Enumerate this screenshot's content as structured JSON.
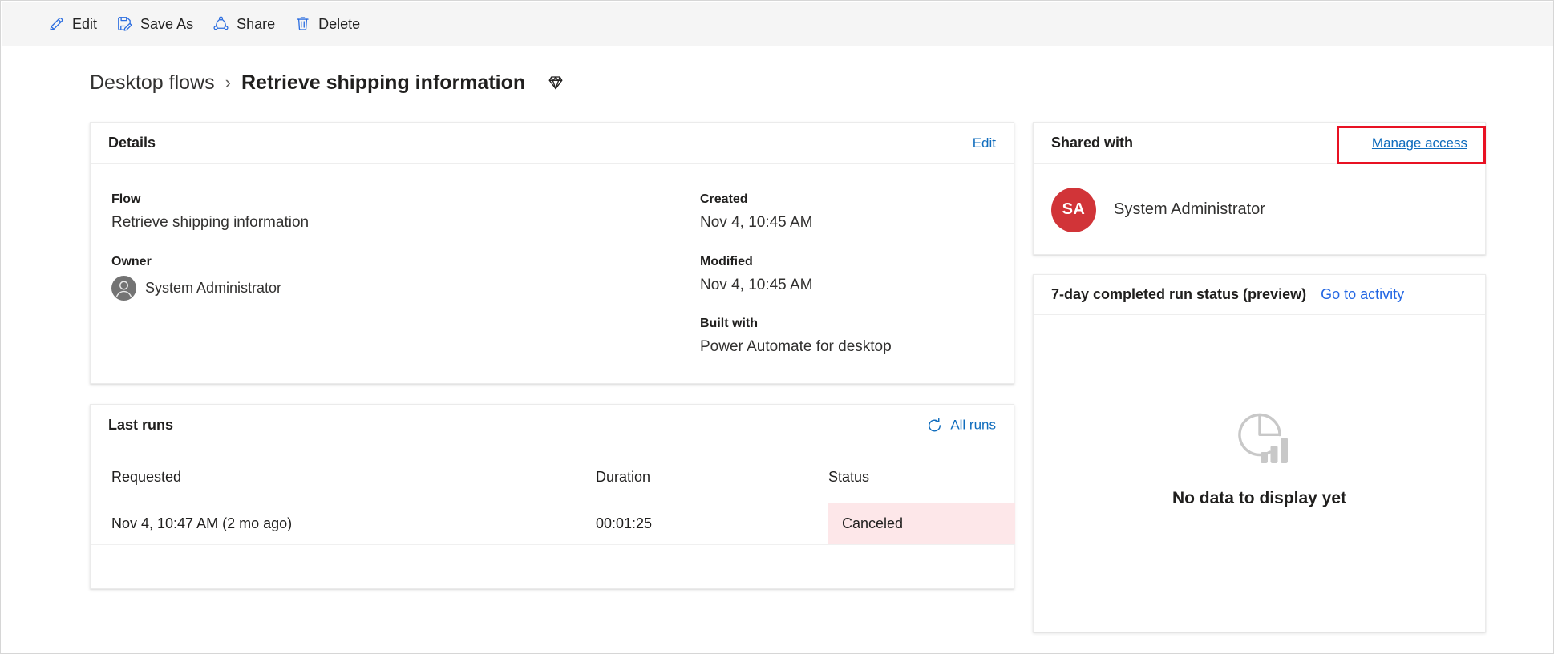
{
  "commandbar": {
    "items": [
      {
        "id": "edit",
        "label": "Edit",
        "icon": "pencil-icon"
      },
      {
        "id": "saveas",
        "label": "Save As",
        "icon": "save-as-icon"
      },
      {
        "id": "share",
        "label": "Share",
        "icon": "share-icon"
      },
      {
        "id": "delete",
        "label": "Delete",
        "icon": "trash-icon"
      }
    ]
  },
  "breadcrumb": {
    "parent": "Desktop flows",
    "separator": "›",
    "current": "Retrieve shipping information",
    "badge_icon": "gem-icon"
  },
  "details": {
    "title": "Details",
    "edit_label": "Edit",
    "fields": {
      "flow_label": "Flow",
      "flow_value": "Retrieve shipping information",
      "owner_label": "Owner",
      "owner_value": "System Administrator",
      "created_label": "Created",
      "created_value": "Nov 4, 10:45 AM",
      "modified_label": "Modified",
      "modified_value": "Nov 4, 10:45 AM",
      "built_with_label": "Built with",
      "built_with_value": "Power Automate for desktop"
    }
  },
  "last_runs": {
    "title": "Last runs",
    "all_runs_label": "All runs",
    "refresh_icon": "refresh-icon",
    "columns": [
      "Requested",
      "Duration",
      "Status"
    ],
    "rows": [
      {
        "requested": "Nov 4, 10:47 AM (2 mo ago)",
        "duration": "00:01:25",
        "status": "Canceled",
        "status_bg": "#fde7e9"
      }
    ]
  },
  "shared_with": {
    "title": "Shared with",
    "manage_access_label": "Manage access",
    "highlight_color": "#e81123",
    "people": [
      {
        "initials": "SA",
        "name": "System Administrator",
        "avatar_color": "#d13438"
      }
    ]
  },
  "run_status": {
    "title": "7-day completed run status (preview)",
    "go_to_activity_label": "Go to activity",
    "empty_icon": "pie-bar-chart-icon",
    "empty_text": "No data to display yet"
  },
  "colors": {
    "accent_link": "#0f6cbd",
    "link_blue": "#2266e3",
    "icon_blue": "#2b6de0",
    "text_primary": "#201f1e",
    "commandbar_bg": "#f5f5f5",
    "card_bg": "#ffffff"
  }
}
